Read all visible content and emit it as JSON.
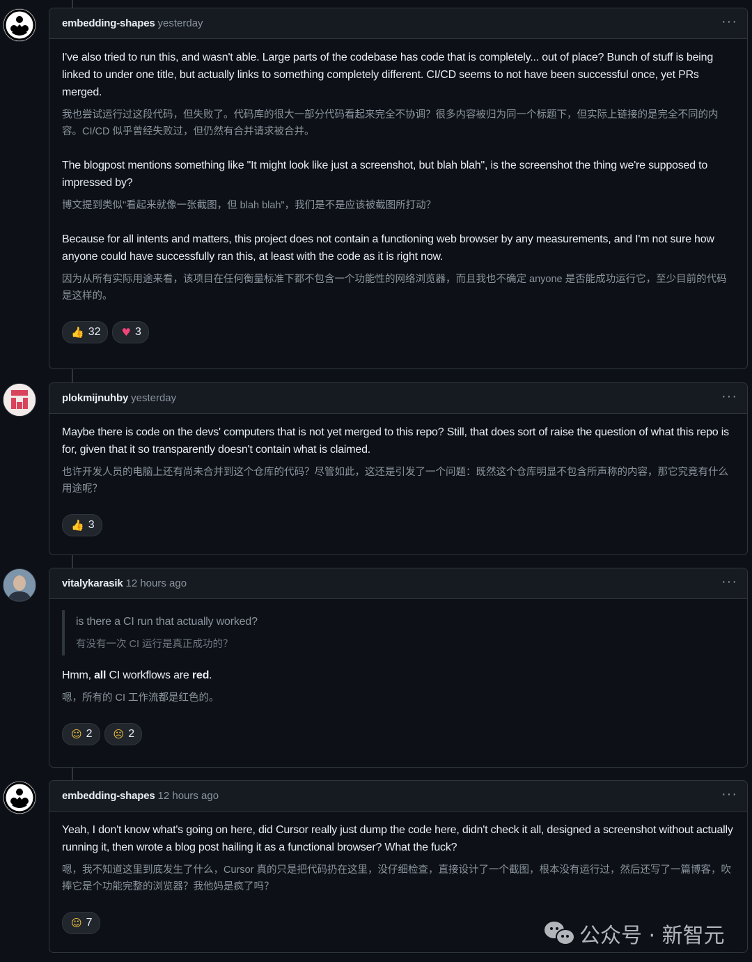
{
  "comments": [
    {
      "author": "embedding-shapes",
      "time": "yesterday",
      "avatar_icon": "circle-dots-avatar-icon",
      "paragraphs": [
        {
          "en": "I've also tried to run this, and wasn't able. Large parts of the codebase has code that is completely... out of place? Bunch of stuff is being linked to under one title, but actually links to something completely different. CI/CD seems to not have been successful once, yet PRs merged.",
          "zh": "我也尝试运行过这段代码，但失败了。代码库的很大一部分代码看起来完全不协调？很多内容被归为同一个标题下，但实际上链接的是完全不同的内容。CI/CD 似乎曾经失败过，但仍然有合并请求被合并。"
        },
        {
          "en": "The blogpost mentions something like \"It might look like just a screenshot, but blah blah\", is the screenshot the thing we're supposed to impressed by?",
          "zh": "博文提到类似\"看起来就像一张截图，但 blah blah\"，我们是不是应该被截图所打动？"
        },
        {
          "en": "Because for all intents and matters, this project does not contain a functioning web browser by any measurements, and I'm not sure how anyone could have successfully ran this, at least with the code as it is right now.",
          "zh": "因为从所有实际用途来看，该项目在任何衡量标准下都不包含一个功能性的网络浏览器，而且我也不确定 anyone 是否能成功运行它，至少目前的代码是这样的。"
        }
      ],
      "reactions": [
        {
          "emoji": "thumbs-up",
          "glyph": "👍",
          "count": "32"
        },
        {
          "emoji": "heart",
          "glyph": "♥",
          "count": "3"
        }
      ]
    },
    {
      "author": "plokmijnuhby",
      "time": "yesterday",
      "avatar_icon": "pixel-identicon-avatar-icon",
      "paragraphs": [
        {
          "en": "Maybe there is code on the devs' computers that is not yet merged to this repo? Still, that does sort of raise the question of what this repo is for, given that it so transparently doesn't contain what is claimed.",
          "zh": "也许开发人员的电脑上还有尚未合并到这个仓库的代码？尽管如此，这还是引发了一个问题：既然这个仓库明显不包含所声称的内容，那它究竟有什么用途呢？"
        }
      ],
      "reactions": [
        {
          "emoji": "thumbs-up",
          "glyph": "👍",
          "count": "3"
        }
      ]
    },
    {
      "author": "vitalykarasik",
      "time": "12 hours ago",
      "avatar_icon": "user-photo-avatar-icon",
      "quote": {
        "en": "is there a CI run that actually worked?",
        "zh": "有没有一次 CI 运行是真正成功的？"
      },
      "paragraphs_rich": {
        "part1": "Hmm, ",
        "bold1": "all",
        "part2": " CI workflows are ",
        "bold2": "red",
        "part3": ".",
        "zh": "嗯，所有的 CI 工作流都是红色的。"
      },
      "reactions": [
        {
          "emoji": "laugh",
          "glyph": "☺",
          "count": "2"
        },
        {
          "emoji": "confused",
          "glyph": "☹",
          "count": "2"
        }
      ]
    },
    {
      "author": "embedding-shapes",
      "time": "12 hours ago",
      "avatar_icon": "circle-dots-avatar-icon",
      "paragraphs": [
        {
          "en": "Yeah, I don't know what's going on here, did Cursor really just dump the code here, didn't check it all, designed a screenshot without actually running it, then wrote a blog post hailing it as a functional browser? What the fuck?",
          "zh": "嗯，我不知道这里到底发生了什么，Cursor 真的只是把代码扔在这里，没仔细检查，直接设计了一个截图，根本没有运行过，然后还写了一篇博客，吹捧它是个功能完整的浏览器？我他妈是疯了吗？"
        }
      ],
      "reactions": [
        {
          "emoji": "laugh",
          "glyph": "☺",
          "count": "7"
        }
      ]
    }
  ],
  "more_glyph": "···",
  "watermark": "公众号 · 新智元"
}
